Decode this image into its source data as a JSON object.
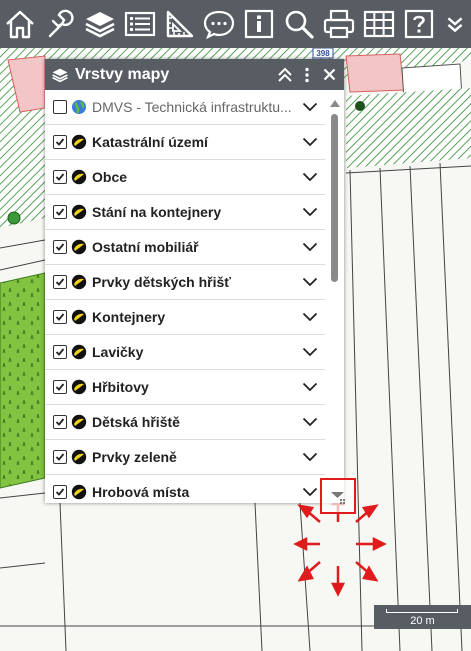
{
  "toolbar": {
    "buttons": [
      {
        "icon": "home-icon"
      },
      {
        "icon": "wrench-icon"
      },
      {
        "icon": "layers-icon"
      },
      {
        "icon": "legend-list-icon"
      },
      {
        "icon": "measure-icon"
      },
      {
        "icon": "comment-icon"
      },
      {
        "icon": "info-icon"
      },
      {
        "icon": "search-icon"
      },
      {
        "icon": "print-icon"
      },
      {
        "icon": "grid-icon"
      },
      {
        "icon": "help-icon"
      },
      {
        "icon": "more-chevron-icon"
      }
    ]
  },
  "map": {
    "road_badge": "398",
    "scale_label": "20 m"
  },
  "layer_panel": {
    "title": "Vrstvy mapy",
    "layers": [
      {
        "name": "DMVS - Technická infrastruktu...",
        "checked": false,
        "icon": "globe-icon",
        "style": "light"
      },
      {
        "name": "Katastrální území",
        "checked": true,
        "icon": "layer-type-icon"
      },
      {
        "name": "Obce",
        "checked": true,
        "icon": "layer-type-icon"
      },
      {
        "name": "Stání na kontejnery",
        "checked": true,
        "icon": "layer-type-icon"
      },
      {
        "name": "Ostatní mobiliář",
        "checked": true,
        "icon": "layer-type-icon"
      },
      {
        "name": "Prvky dětských hřišť",
        "checked": true,
        "icon": "layer-type-icon"
      },
      {
        "name": "Kontejnery",
        "checked": true,
        "icon": "layer-type-icon"
      },
      {
        "name": "Lavičky",
        "checked": true,
        "icon": "layer-type-icon"
      },
      {
        "name": "Hřbitovy",
        "checked": true,
        "icon": "layer-type-icon"
      },
      {
        "name": "Dětská hřiště",
        "checked": true,
        "icon": "layer-type-icon"
      },
      {
        "name": "Prvky zeleně",
        "checked": true,
        "icon": "layer-type-icon"
      },
      {
        "name": "Hrobová místa",
        "checked": true,
        "icon": "layer-type-icon"
      }
    ]
  },
  "colors": {
    "toolbar_bg": "#585d64",
    "accent_red": "#e01b1b",
    "park_green": "#7cc243",
    "hatch_green": "#2e8b2e",
    "parcel_pink": "#f0b4b4"
  }
}
